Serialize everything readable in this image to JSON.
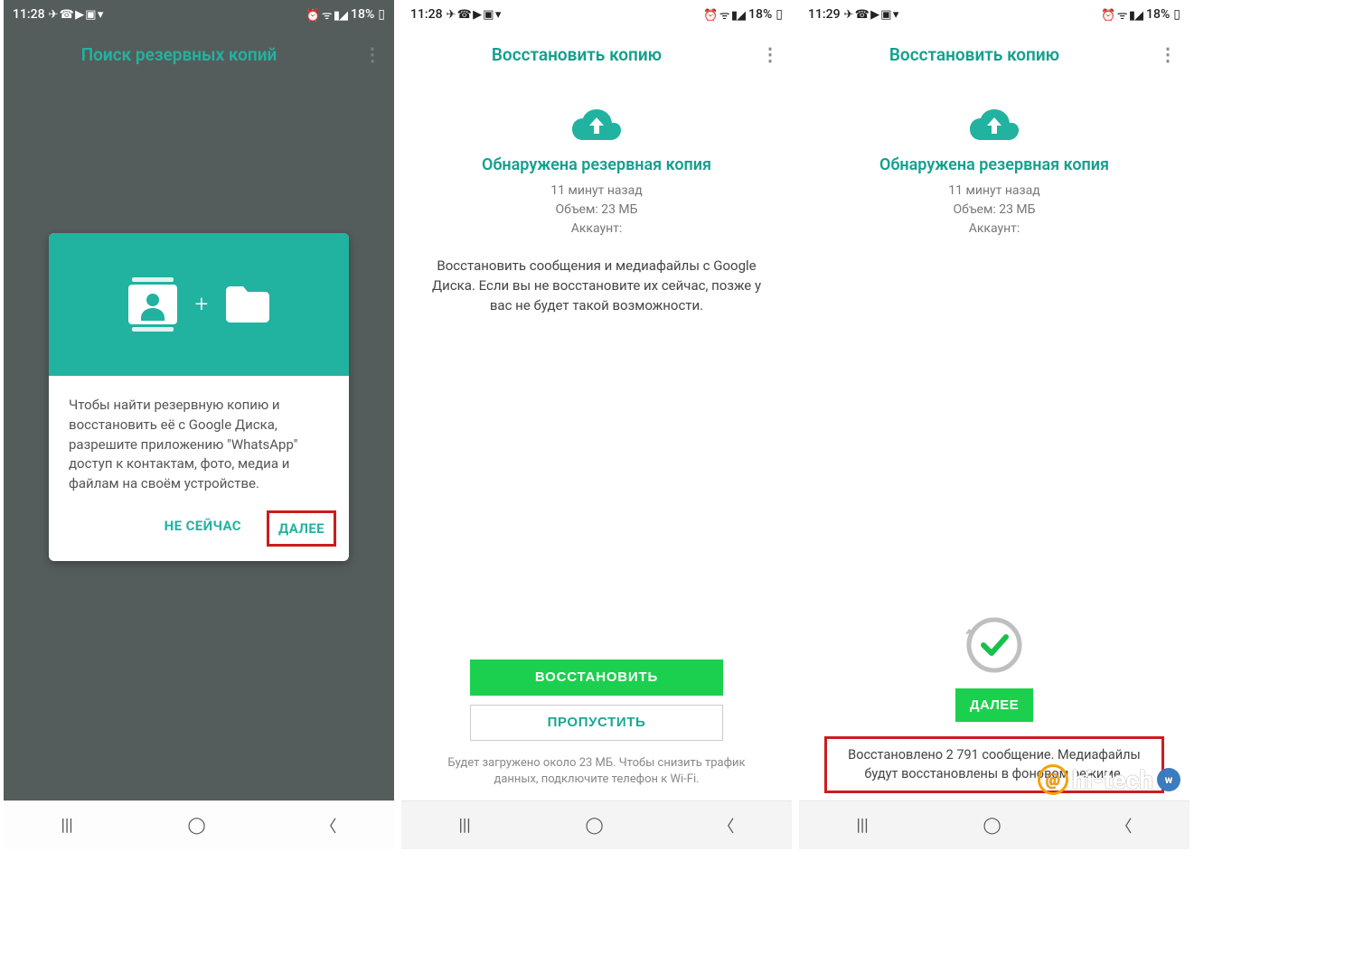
{
  "status": {
    "time_a": "11:28",
    "time_b": "11:28",
    "time_c": "11:29",
    "battery": "18%"
  },
  "screen1": {
    "title": "Поиск резервных копий",
    "card_text": "Чтобы найти резервную копию и восстановить её с Google Диска, разрешите приложению \"WhatsApp\" доступ к контактам, фото, медиа и файлам на своём устройстве.",
    "not_now": "НЕ СЕЙЧАС",
    "next": "ДАЛЕЕ"
  },
  "screen2": {
    "title": "Восстановить копию",
    "found": "Обнаружена резервная копия",
    "time_ago": "11 минут назад",
    "size": "Объем: 23 МБ",
    "account": "Аккаунт:",
    "desc": "Восстановить сообщения и медиафайлы с Google Диска. Если вы не восстановите их сейчас, позже у вас не будет такой возможности.",
    "restore": "ВОССТАНОВИТЬ",
    "skip": "ПРОПУСТИТЬ",
    "footnote": "Будет загружено около 23 МБ. Чтобы снизить трафик данных, подключите телефон к Wi-Fi."
  },
  "screen3": {
    "title": "Восстановить копию",
    "found": "Обнаружена резервная копия",
    "time_ago": "11 минут назад",
    "size": "Объем: 23 МБ",
    "account": "Аккаунт:",
    "next": "ДАЛЕЕ",
    "restored": "Восстановлено 2 791 сообщение. Медиафайлы будут восстановлены в фоновом режиме."
  },
  "watermark": {
    "text": "hi-tech"
  }
}
